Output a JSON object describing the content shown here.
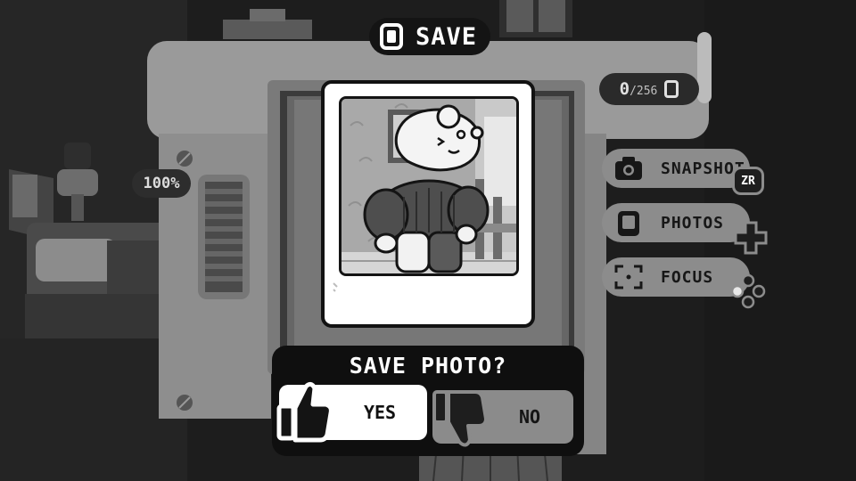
{
  "header": {
    "title": "SAVE",
    "icon": "photo-icon"
  },
  "counter": {
    "current": "0",
    "total": "/256",
    "icon": "photo-icon"
  },
  "zoom": {
    "label": "100%"
  },
  "menu": {
    "items": [
      {
        "label": "SNAPSHOT",
        "icon": "camera-icon",
        "button_hint": "ZR"
      },
      {
        "label": "PHOTOS",
        "icon": "photo-icon",
        "button_hint": "dpad-icon"
      },
      {
        "label": "FOCUS",
        "icon": "focus-icon",
        "button_hint": "face-buttons-icon"
      }
    ]
  },
  "dialog": {
    "title": "SAVE PHOTO?",
    "yes_label": "YES",
    "no_label": "NO"
  }
}
